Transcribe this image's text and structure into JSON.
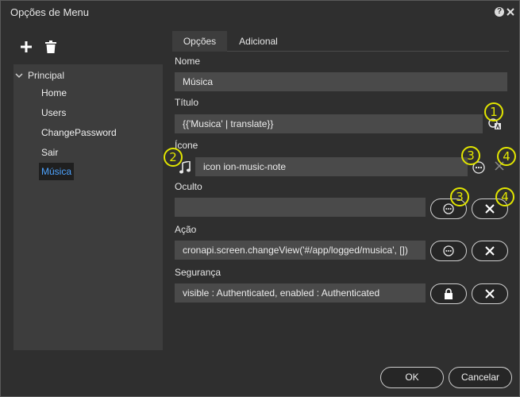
{
  "window": {
    "title": "Opções de Menu",
    "help_label": "?"
  },
  "toolbar": {
    "add_icon": "plus-icon",
    "delete_icon": "trash-icon"
  },
  "tree": {
    "root_label": "Principal",
    "items": [
      {
        "label": "Home",
        "selected": false
      },
      {
        "label": "Users",
        "selected": false
      },
      {
        "label": "ChangePassword",
        "selected": false
      },
      {
        "label": "Sair",
        "selected": false
      },
      {
        "label": "Música",
        "selected": true
      }
    ]
  },
  "tabs": [
    {
      "label": "Opções",
      "active": true
    },
    {
      "label": "Adicional",
      "active": false
    }
  ],
  "form": {
    "nome": {
      "label": "Nome",
      "value": "Música"
    },
    "titulo": {
      "label": "Título",
      "value": "{{'Musica' | translate}}"
    },
    "icone": {
      "label": "Ícone",
      "value": "icon ion-music-note",
      "icon": "music-note-icon"
    },
    "oculto": {
      "label": "Oculto",
      "value": ""
    },
    "acao": {
      "label": "Ação",
      "value": "cronapi.screen.changeView('#/app/logged/musica', [])"
    },
    "seguranca": {
      "label": "Segurança",
      "value": "visible : Authenticated, enabled : Authenticated"
    }
  },
  "callouts": {
    "one": "1",
    "two": "2",
    "three_a": "3",
    "four_a": "4",
    "three_b": "3",
    "four_b": "4"
  },
  "footer": {
    "ok_label": "OK",
    "cancel_label": "Cancelar"
  },
  "colors": {
    "selected_text": "#4da3ff",
    "callout": "#e2e600"
  }
}
